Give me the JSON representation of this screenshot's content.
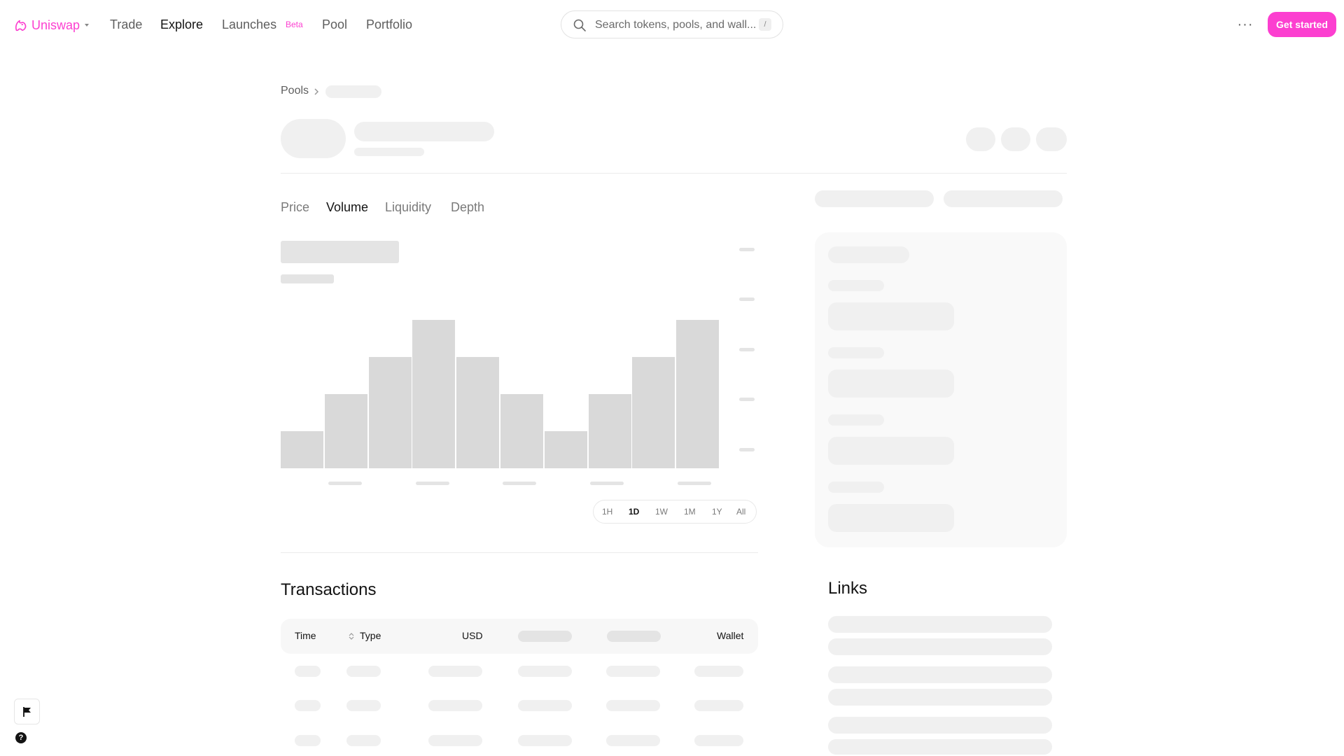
{
  "nav": {
    "brand": "Uniswap",
    "links": [
      "Trade",
      "Explore",
      "Launches",
      "Pool",
      "Portfolio"
    ],
    "beta_badge": "Beta",
    "search_placeholder": "Search tokens, pools, and wall...",
    "search_shortcut": "/",
    "more": "···",
    "get_started": "Get started"
  },
  "breadcrumb": {
    "root": "Pools"
  },
  "chart_tabs": [
    "Price",
    "Volume",
    "Liquidity",
    "Depth"
  ],
  "active_tab": "Volume",
  "timeframes": [
    "1H",
    "1D",
    "1W",
    "1M",
    "1Y",
    "All"
  ],
  "active_timeframe": "1D",
  "chart_data": {
    "type": "bar",
    "values": [
      1,
      2,
      3,
      4,
      3,
      2,
      1,
      2,
      3,
      4
    ],
    "ylim": [
      0,
      4
    ]
  },
  "transactions": {
    "title": "Transactions",
    "columns": [
      "Time",
      "Type",
      "USD",
      "Wallet"
    ]
  },
  "links": {
    "title": "Links"
  },
  "colors": {
    "accent": "#fc3fd0",
    "skeleton": "#f0f0f0",
    "bar": "#d9d9d9"
  }
}
